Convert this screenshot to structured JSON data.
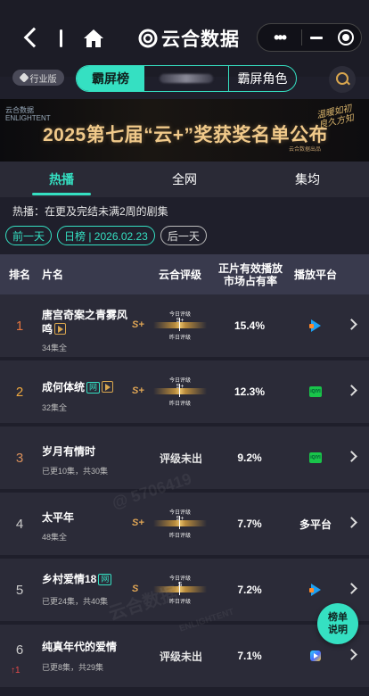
{
  "nav": {
    "title": "云合数据",
    "menu_dots": "•••"
  },
  "filter": {
    "industry_badge": "行业版",
    "tab_active": "霸屏榜",
    "tab_other": "霸屏角色"
  },
  "banner": {
    "logo_text": "云合数据",
    "logo_sub": "ENLIGHTENT",
    "title": "2025第七届“云+”奖获奖名单公布",
    "sub": "云合数据出品",
    "signature": "温暖如初 良久方知"
  },
  "tabs": [
    "热播",
    "全网",
    "集均"
  ],
  "note": "热播：在更及完结未满2周的剧集",
  "datebar": {
    "prev": "前一天",
    "current": "日榜 | 2026.02.23",
    "next": "后一天"
  },
  "table": {
    "headers": {
      "rank": "排名",
      "name": "片名",
      "grade": "云合评级",
      "share": "正片有效播放市场占有率",
      "platform": "播放平台"
    },
    "gauge_top": "今日评级",
    "gauge_bottom": "昨日评级",
    "rows": [
      {
        "rank": "1",
        "name": "唐宫奇案之青雾风鸣",
        "eps": "34集全",
        "grade": "S+",
        "grade_today": "S+",
        "share": "15.4%",
        "platform": "tencent-video-icon",
        "has_play_tag": true
      },
      {
        "rank": "2",
        "name": "成何体统",
        "tag": "网",
        "eps": "32集全",
        "grade": "S+",
        "grade_today": "S+",
        "share": "12.3%",
        "platform": "iqiyi-icon",
        "has_play_tag": true
      },
      {
        "rank": "3",
        "name": "岁月有情时",
        "eps": "已更10集，共30集",
        "grade_text": "评级未出",
        "share": "9.2%",
        "platform": "iqiyi-icon"
      },
      {
        "rank": "4",
        "name": "太平年",
        "eps": "48集全",
        "grade": "S+",
        "grade_today": "S+",
        "share": "7.7%",
        "platform_text": "多平台"
      },
      {
        "rank": "5",
        "name": "乡村爱情18",
        "tag": "网",
        "eps": "已更24集，共40集",
        "grade": "S",
        "grade_today": "S",
        "share": "7.2%",
        "platform": "tencent-video-icon"
      },
      {
        "rank": "6",
        "name": "纯真年代的爱情",
        "eps": "已更8集，共29集",
        "grade_text": "评级未出",
        "share": "7.1%",
        "platform": "youku-icon",
        "rank_change": "↑1"
      }
    ]
  },
  "watermark": {
    "brand": "云合数据",
    "brand_en": "ENLIGHTENT",
    "id": "@ 5706419"
  },
  "float_button": {
    "line1": "榜单",
    "line2": "说明"
  },
  "colors": {
    "accent": "#35e0c2",
    "gold": "#e0a655",
    "bg": "#1f1f2b",
    "row_bg": "#2b2b38",
    "header_bg": "#393a4d"
  }
}
